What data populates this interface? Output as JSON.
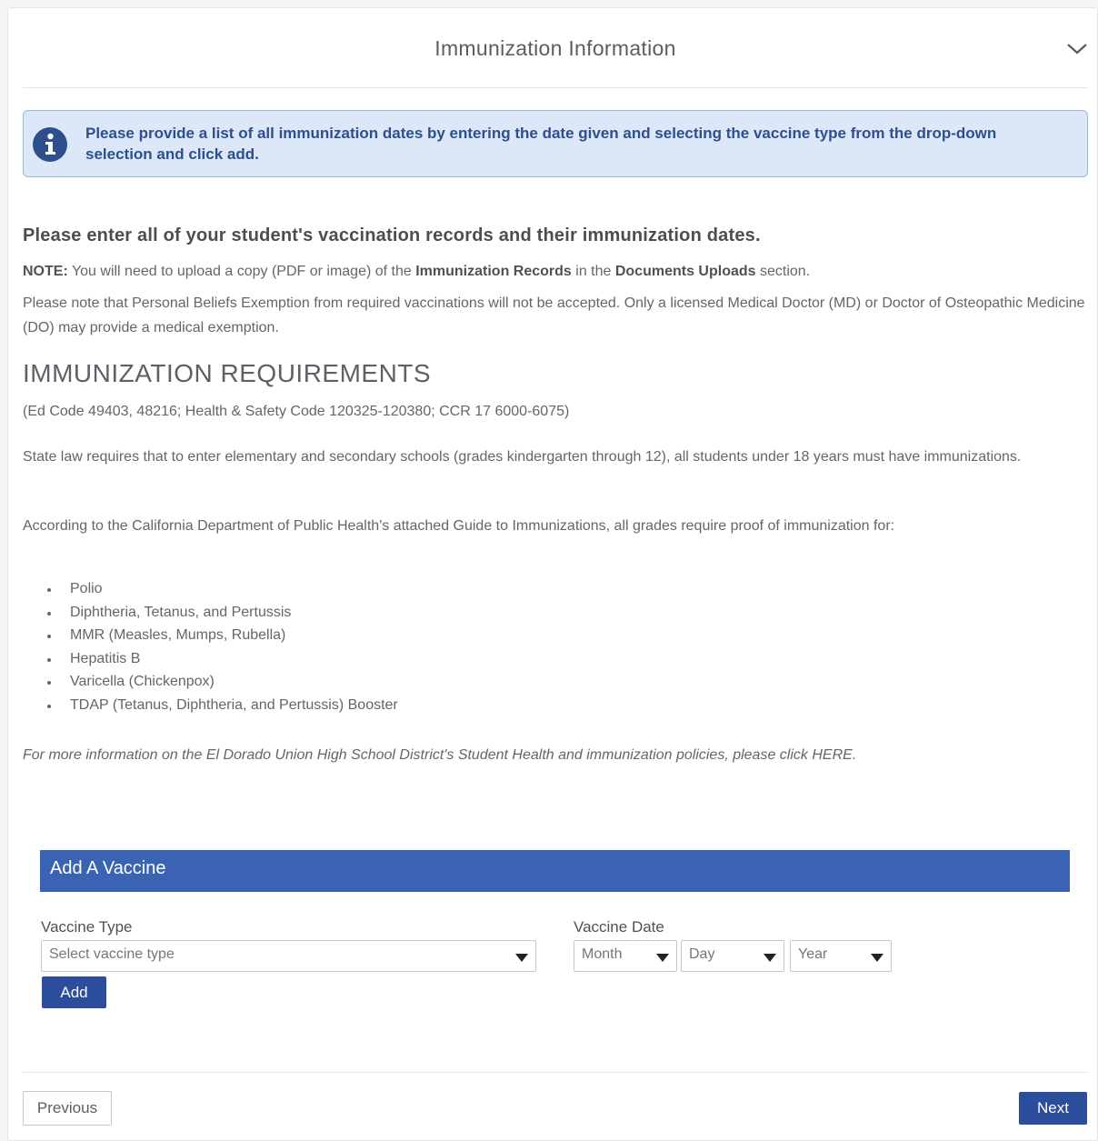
{
  "header": {
    "title": "Immunization Information"
  },
  "info": {
    "text": "Please provide a list of all immunization dates by entering the date given and selecting the vaccine type from the drop-down selection and click add."
  },
  "intro": {
    "heading": "Please enter all of your student's vaccination records and their immunization dates.",
    "note_label": "NOTE:",
    "note_part1": " You will need to upload a copy (PDF or image) of the ",
    "note_bold1": "Immunization Records",
    "note_part2": " in the ",
    "note_bold2": "Documents Uploads",
    "note_part3": " section.",
    "exemption": "Please note that Personal Beliefs Exemption from required vaccinations will not be accepted. Only a licensed Medical Doctor (MD) or Doctor of Osteopathic Medicine (DO) may provide a medical exemption."
  },
  "requirements": {
    "title": "IMMUNIZATION REQUIREMENTS",
    "codes": "(Ed Code 49403, 48216; Health & Safety Code 120325-120380; CCR 17 6000-6075)",
    "state_law": "State law requires that to enter elementary and secondary schools (grades kindergarten through 12), all students under 18 years must have immunizations.",
    "guide": "According to the California Department of Public Health's attached Guide to Immunizations, all grades require proof of immunization for:",
    "items": [
      "Polio",
      "Diphtheria, Tetanus, and Pertussis",
      "MMR (Measles, Mumps, Rubella)",
      "Hepatitis B",
      "Varicella (Chickenpox)",
      "TDAP (Tetanus, Diphtheria, and Pertussis) Booster"
    ],
    "more_info": "For more information on the El Dorado Union High School District's Student Health and immunization policies, please click ",
    "link": "HERE",
    "more_info_end": "."
  },
  "add_vaccine": {
    "title": "Add A Vaccine",
    "type_label": "Vaccine Type",
    "type_placeholder": "Select vaccine type",
    "date_label": "Vaccine Date",
    "month": "Month",
    "day": "Day",
    "year": "Year",
    "add_button": "Add"
  },
  "footer": {
    "previous": "Previous",
    "next": "Next"
  },
  "colors": {
    "accent": "#3a64b3",
    "button": "#2c4c9c",
    "info_bg": "#dce8f8",
    "info_text": "#2d4f8d"
  }
}
